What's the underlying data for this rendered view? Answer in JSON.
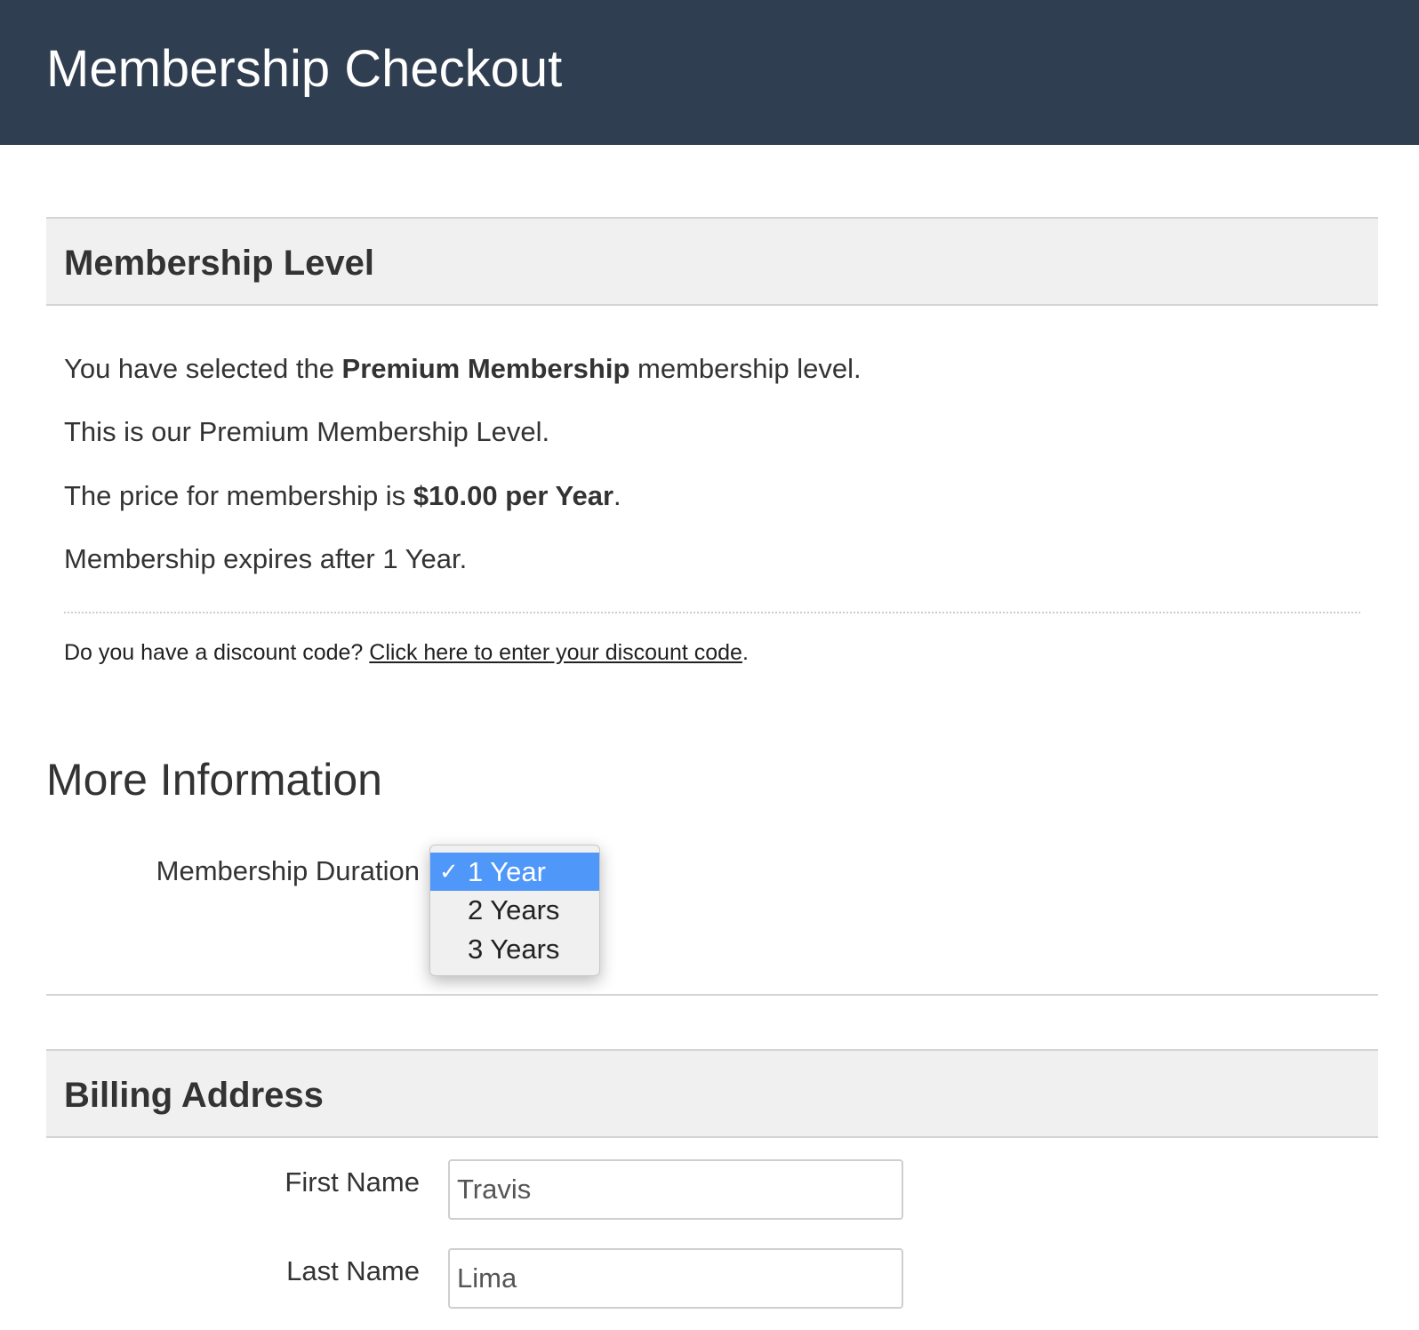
{
  "header": {
    "title": "Membership Checkout"
  },
  "membership_level": {
    "heading": "Membership Level",
    "selected_prefix": "You have selected the ",
    "selected_level": "Premium Membership",
    "selected_suffix": " membership level.",
    "description": "This is our Premium Membership Level.",
    "price_prefix": "The price for membership is ",
    "price": "$10.00 per Year",
    "price_suffix": ".",
    "expiry": "Membership expires after 1 Year.",
    "discount_prompt": "Do you have a discount code? ",
    "discount_link": "Click here to enter your discount code",
    "discount_suffix": "."
  },
  "more_information": {
    "heading": "More Information",
    "duration_label": "Membership Duration",
    "duration_options": [
      "1 Year",
      "2 Years",
      "3 Years"
    ],
    "duration_selected": "1 Year",
    "check_glyph": "✓"
  },
  "billing_address": {
    "heading": "Billing Address",
    "first_name_label": "First Name",
    "first_name_value": "Travis",
    "last_name_label": "Last Name",
    "last_name_value": "Lima"
  },
  "colors": {
    "header_bg": "#2f3e50",
    "section_bg": "#f0f0f0",
    "selection_blue": "#4f97f8"
  }
}
